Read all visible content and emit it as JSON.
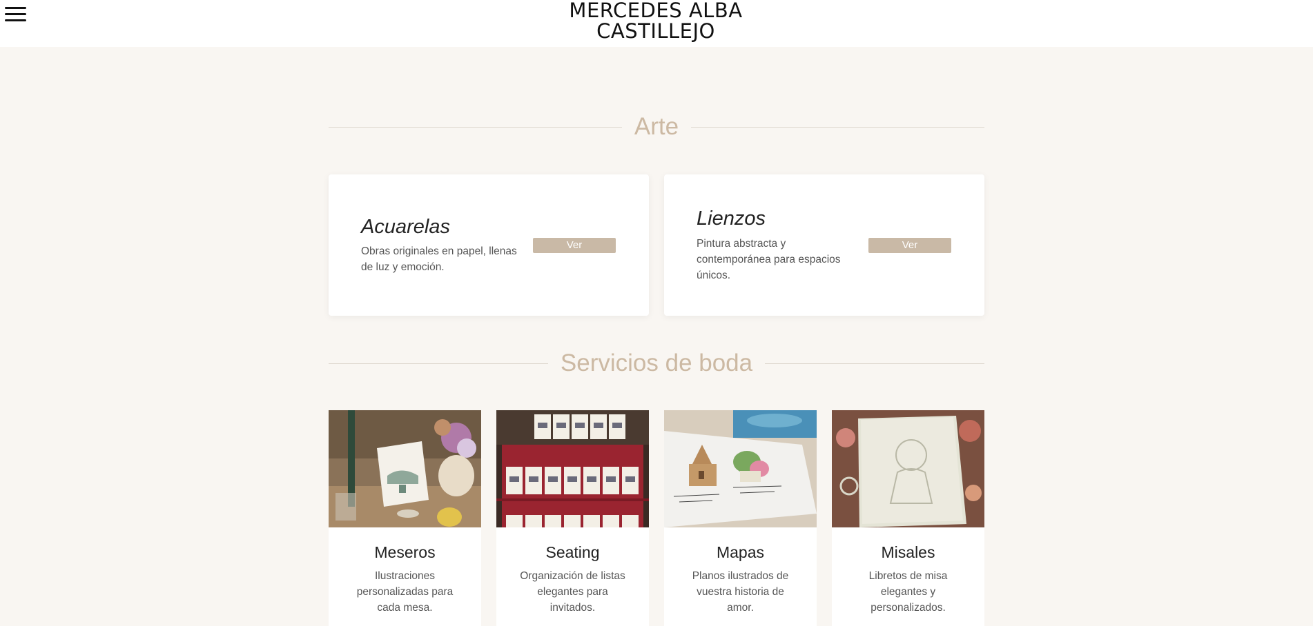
{
  "header": {
    "logo_line1": "MERCEDES ALBA",
    "logo_line2": "CASTILLEJO",
    "menu_icon": "hamburger-menu-icon"
  },
  "sections": {
    "arte_title": "Arte",
    "boda_title": "Servicios de boda"
  },
  "art_cards": [
    {
      "title": "Acuarelas",
      "description": "Obras originales en papel, llenas de luz y emoción.",
      "button": "Ver"
    },
    {
      "title": "Lienzos",
      "description": "Pintura abstracta y contemporánea para espacios únicos.",
      "button": "Ver"
    }
  ],
  "services": [
    {
      "title": "Meseros",
      "description": "Ilustraciones personalizadas para cada mesa."
    },
    {
      "title": "Seating",
      "description": "Organización de listas elegantes para invitados."
    },
    {
      "title": "Mapas",
      "description": "Planos ilustrados de vuestra historia de amor."
    },
    {
      "title": "Misales",
      "description": "Libretos de misa elegantes y personalizados."
    }
  ],
  "colors": {
    "background": "#f9f6f2",
    "accent": "#ccb9a3",
    "button": "#c9b9a6"
  }
}
